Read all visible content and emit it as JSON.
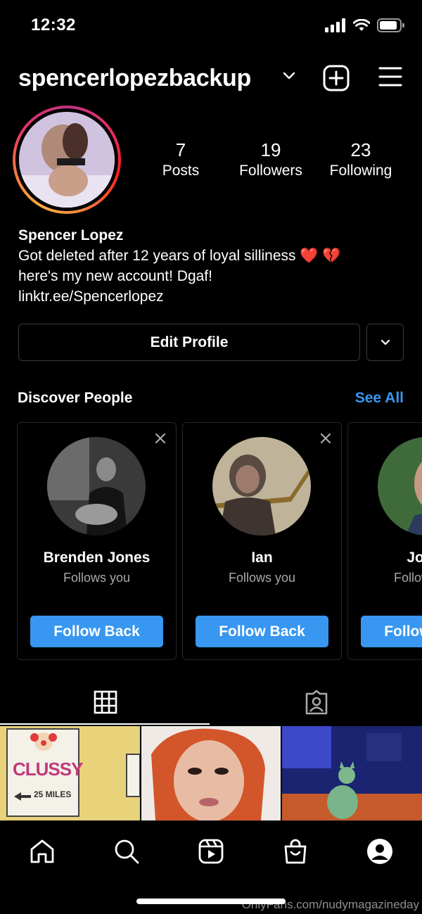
{
  "status": {
    "time": "12:32"
  },
  "header": {
    "username": "spencerlopezbackup"
  },
  "profile": {
    "posts_count": "7",
    "posts_label": "Posts",
    "followers_count": "19",
    "followers_label": "Followers",
    "following_count": "23",
    "following_label": "Following",
    "name": "Spencer Lopez",
    "bio_line1": "Got deleted after 12 years of loyal silliness ❤️ 💔",
    "bio_line2": "here's my new account! Dgaf!",
    "link": "linktr.ee/Spencerlopez",
    "edit_label": "Edit Profile"
  },
  "discover": {
    "title": "Discover People",
    "see_all": "See All",
    "cards": [
      {
        "name": "Brenden Jones",
        "sub": "Follows you",
        "button": "Follow Back"
      },
      {
        "name": "Ian",
        "sub": "Follows you",
        "button": "Follow Back"
      },
      {
        "name": "Joe G",
        "sub": "Follows you",
        "button": "Follow Back"
      }
    ]
  },
  "grid": {
    "cell1_sign": "CLUSSY",
    "cell1_miles": "25 MILES"
  },
  "watermark": "OnlyFans.com/nudymagazineday",
  "colors": {
    "accent": "#3897f0",
    "background": "#000000"
  },
  "icons": [
    "signal-icon",
    "wifi-icon",
    "battery-icon",
    "chevron-down-icon",
    "new-post-icon",
    "menu-icon",
    "close-icon",
    "grid-icon",
    "tagged-icon",
    "home-icon",
    "search-icon",
    "reels-icon",
    "shop-icon",
    "profile-icon"
  ]
}
